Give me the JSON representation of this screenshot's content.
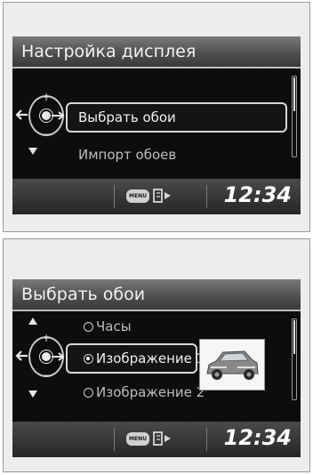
{
  "screen1": {
    "title": "Настройка дисплея",
    "selected_item": "Выбрать обои",
    "next_item": "Импорт обоев",
    "menu_label": "MENU",
    "clock": "12:34",
    "icons": [
      "back-arrow-icon",
      "dial-icon",
      "plus-icon",
      "minus-icon",
      "down-arrow-icon",
      "menu-icon",
      "exit-icon"
    ]
  },
  "screen2": {
    "title": "Выбрать обои",
    "options": [
      {
        "label": "Часы",
        "checked": false
      },
      {
        "label": "Изображение 1",
        "checked": true
      },
      {
        "label": "Изображение 2",
        "checked": false
      }
    ],
    "menu_label": "MENU",
    "clock": "12:34",
    "icons": [
      "up-arrow-icon",
      "back-arrow-icon",
      "dial-icon",
      "down-arrow-icon",
      "car-thumbnail-icon",
      "menu-icon",
      "exit-icon"
    ]
  },
  "colors": {
    "screen_bg": "#0d0d0d",
    "panel_bg": "#ededed",
    "text": "#f0f0f0"
  }
}
